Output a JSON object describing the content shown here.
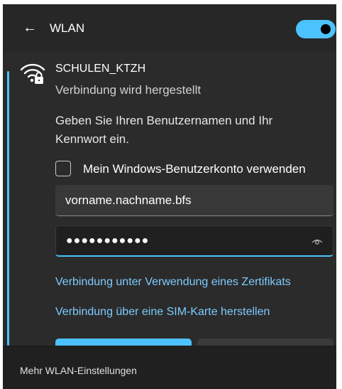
{
  "header": {
    "title": "WLAN",
    "toggle_on": true
  },
  "network": {
    "name": "SCHULEN_KTZH",
    "status": "Verbindung wird hergestellt"
  },
  "form": {
    "prompt": "Geben Sie Ihren Benutzernamen und Ihr Kennwort ein.",
    "checkbox_label": "Mein Windows-Benutzerkonto verwenden",
    "checkbox_checked": false,
    "username_value": "vorname.nachname.bfs",
    "password_masked": "●●●●●●●●●●●"
  },
  "links": {
    "certificate": "Verbindung unter Verwendung eines Zertifikats",
    "sim": "Verbindung über eine SIM-Karte herstellen"
  },
  "footer": {
    "label": "Mehr WLAN-Einstellungen"
  },
  "colors": {
    "accent": "#4cc2ff",
    "panel": "#272727",
    "link": "#7dcbff"
  }
}
